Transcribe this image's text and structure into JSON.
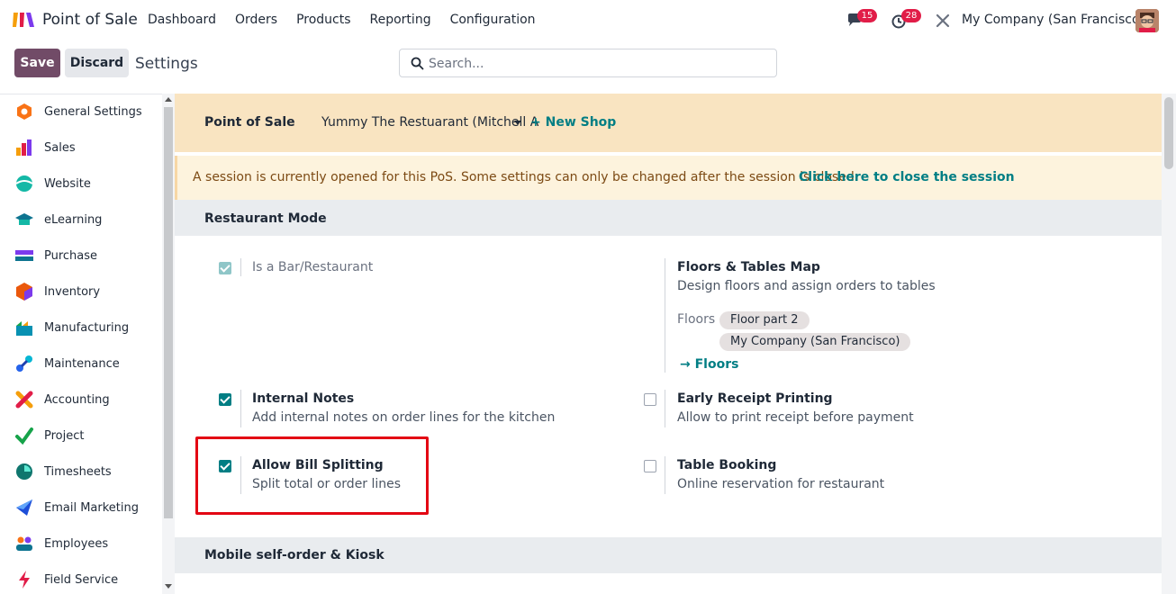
{
  "app": {
    "name": "Point of Sale",
    "menu": [
      "Dashboard",
      "Orders",
      "Products",
      "Reporting",
      "Configuration"
    ]
  },
  "systray": {
    "messages_count": "15",
    "activities_count": "28",
    "company": "My Company (San Francisco)"
  },
  "control_panel": {
    "save_label": "Save",
    "discard_label": "Discard",
    "breadcrumb": "Settings",
    "search_placeholder": "Search..."
  },
  "sidebar": {
    "items": [
      {
        "label": "General Settings",
        "icon": "general-settings-icon",
        "color": "#f97316"
      },
      {
        "label": "Sales",
        "icon": "sales-icon",
        "color": "#e11d48"
      },
      {
        "label": "Website",
        "icon": "website-icon",
        "color": "#14b8a6"
      },
      {
        "label": "eLearning",
        "icon": "elearning-icon",
        "color": "#0e7490"
      },
      {
        "label": "Purchase",
        "icon": "purchase-icon",
        "color": "#7c3aed"
      },
      {
        "label": "Inventory",
        "icon": "inventory-icon",
        "color": "#ea580c"
      },
      {
        "label": "Manufacturing",
        "icon": "manufacturing-icon",
        "color": "#0891b2"
      },
      {
        "label": "Maintenance",
        "icon": "maintenance-icon",
        "color": "#2563eb"
      },
      {
        "label": "Accounting",
        "icon": "accounting-icon",
        "color": "#f59e0b"
      },
      {
        "label": "Project",
        "icon": "project-icon",
        "color": "#16a34a"
      },
      {
        "label": "Timesheets",
        "icon": "timesheets-icon",
        "color": "#0f766e"
      },
      {
        "label": "Email Marketing",
        "icon": "email-marketing-icon",
        "color": "#1d4ed8"
      },
      {
        "label": "Employees",
        "icon": "employees-icon",
        "color": "#f97316"
      },
      {
        "label": "Field Service",
        "icon": "field-service-icon",
        "color": "#e11d48"
      }
    ]
  },
  "pos_bar": {
    "label": "Point of Sale",
    "shop": "Yummy The Restuarant (Mitchell A",
    "new_shop": "+ New Shop"
  },
  "session_alert": {
    "text": "A session is currently opened for this PoS. Some settings can only be changed after the session is closed.",
    "link": "Click here to close the session"
  },
  "sections": {
    "restaurant": "Restaurant Mode",
    "mobile": "Mobile self-order & Kiosk"
  },
  "settings": {
    "bar_restaurant": {
      "title": "Is a Bar/Restaurant",
      "checked": true
    },
    "floors_map": {
      "title": "Floors & Tables Map",
      "desc": "Design floors and assign orders to tables",
      "floors_label": "Floors",
      "tags": [
        "Floor part 2",
        "My Company (San Francisco)"
      ],
      "link": "→ Floors"
    },
    "internal_notes": {
      "title": "Internal Notes",
      "desc": "Add internal notes on order lines for the kitchen",
      "checked": true
    },
    "early_receipt": {
      "title": "Early Receipt Printing",
      "desc": "Allow to print receipt before payment",
      "checked": false
    },
    "bill_splitting": {
      "title": "Allow Bill Splitting",
      "desc": "Split total or order lines",
      "checked": true
    },
    "table_booking": {
      "title": "Table Booking",
      "desc": "Online reservation for restaurant",
      "checked": false
    }
  },
  "colors": {
    "brand": "#714b67",
    "accent": "#017e84",
    "highlight": "#e30613"
  }
}
